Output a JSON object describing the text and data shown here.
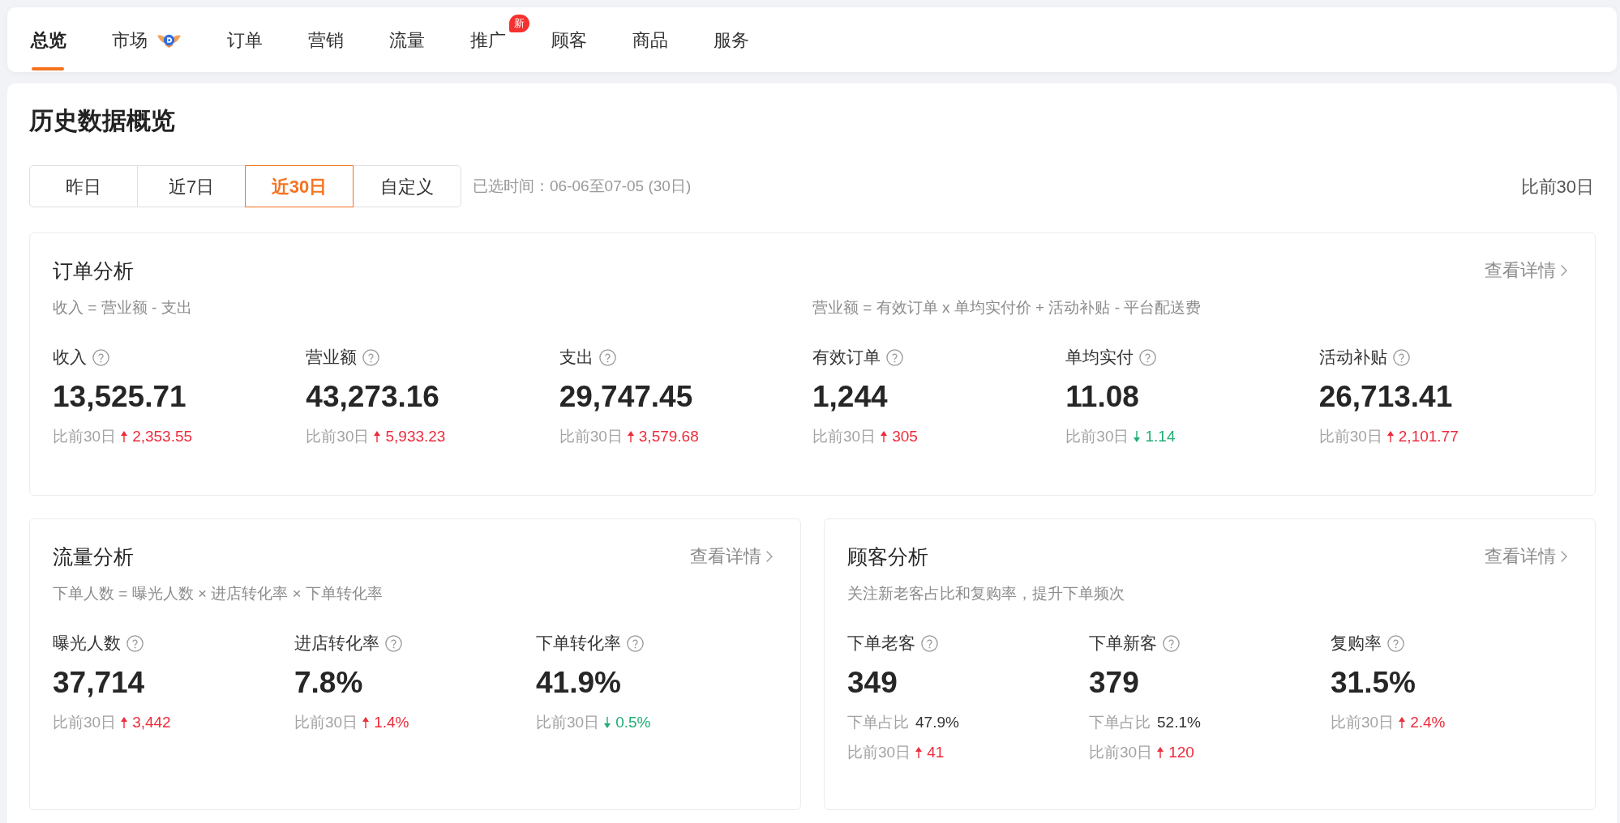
{
  "nav": {
    "tabs": [
      {
        "label": "总览",
        "selected": true,
        "kind": "plain"
      },
      {
        "label": "市场",
        "selected": false,
        "kind": "icon"
      },
      {
        "label": "订单",
        "selected": false,
        "kind": "plain"
      },
      {
        "label": "营销",
        "selected": false,
        "kind": "plain"
      },
      {
        "label": "流量",
        "selected": false,
        "kind": "plain"
      },
      {
        "label": "推广",
        "selected": false,
        "kind": "badge",
        "badge": "新"
      },
      {
        "label": "顾客",
        "selected": false,
        "kind": "plain"
      },
      {
        "label": "商品",
        "selected": false,
        "kind": "plain"
      },
      {
        "label": "服务",
        "selected": false,
        "kind": "plain"
      }
    ]
  },
  "overview": {
    "title": "历史数据概览",
    "ranges": [
      {
        "label": "昨日",
        "selected": false
      },
      {
        "label": "近7日",
        "selected": false
      },
      {
        "label": "近30日",
        "selected": true
      },
      {
        "label": "自定义",
        "selected": false
      }
    ],
    "selected_time": "已选时间：06-06至07-05 (30日)",
    "compare": "比前30日"
  },
  "order_analysis": {
    "title": "订单分析",
    "link": "查看详情",
    "formulas": [
      "收入 = 营业额 - 支出",
      "营业额 = 有效订单 x 单均实付价 + 活动补贴 - 平台配送费"
    ],
    "metrics": [
      {
        "label": "收入",
        "value": "13,525.71",
        "compare_label": "比前30日",
        "increase": true,
        "change": "2,353.55"
      },
      {
        "label": "营业额",
        "value": "43,273.16",
        "compare_label": "比前30日",
        "increase": true,
        "change": "5,933.23"
      },
      {
        "label": "支出",
        "value": "29,747.45",
        "compare_label": "比前30日",
        "increase": true,
        "change": "3,579.68"
      },
      {
        "label": "有效订单",
        "value": "1,244",
        "compare_label": "比前30日",
        "increase": true,
        "change": "305"
      },
      {
        "label": "单均实付",
        "value": "11.08",
        "compare_label": "比前30日",
        "increase": false,
        "change": "1.14"
      },
      {
        "label": "活动补贴",
        "value": "26,713.41",
        "compare_label": "比前30日",
        "increase": true,
        "change": "2,101.77"
      }
    ]
  },
  "traffic_analysis": {
    "title": "流量分析",
    "link": "查看详情",
    "formulas": [
      "下单人数 = 曝光人数 × 进店转化率 × 下单转化率"
    ],
    "metrics": [
      {
        "label": "曝光人数",
        "value": "37,714",
        "compare_label": "比前30日",
        "increase": true,
        "change": "3,442"
      },
      {
        "label": "进店转化率",
        "value": "7.8%",
        "compare_label": "比前30日",
        "increase": true,
        "change": "1.4%"
      },
      {
        "label": "下单转化率",
        "value": "41.9%",
        "compare_label": "比前30日",
        "increase": false,
        "change": "0.5%"
      }
    ]
  },
  "customer_analysis": {
    "title": "顾客分析",
    "link": "查看详情",
    "formulas": [
      "关注新老客占比和复购率，提升下单频次"
    ],
    "metrics": [
      {
        "label": "下单老客",
        "value": "349",
        "share": {
          "label": "下单占比",
          "value": "47.9%"
        },
        "compare_label": "比前30日",
        "increase": true,
        "change": "41"
      },
      {
        "label": "下单新客",
        "value": "379",
        "share": {
          "label": "下单占比",
          "value": "52.1%"
        },
        "compare_label": "比前30日",
        "increase": true,
        "change": "120"
      },
      {
        "label": "复购率",
        "value": "31.5%",
        "compare_label": "比前30日",
        "increase": true,
        "change": "2.4%"
      }
    ]
  }
}
